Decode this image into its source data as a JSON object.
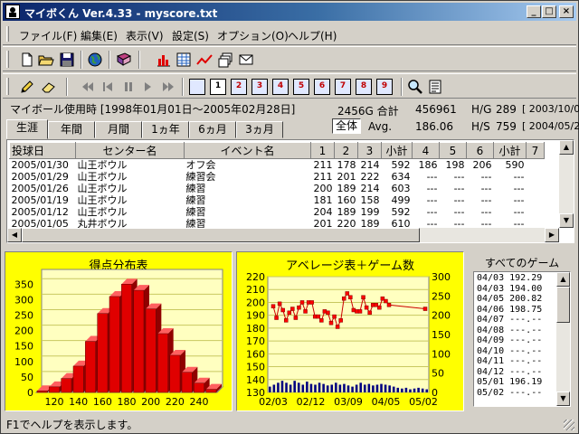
{
  "window": {
    "title": "マイボくん Ver.4.33 - myscore.txt",
    "minimize": "_",
    "maximize": "□",
    "close": "×"
  },
  "menu": [
    "ファイル(F)",
    "編集(E)",
    "表示(V)",
    "設定(S)",
    "オプション(O)",
    "ヘルプ(H)"
  ],
  "toolbar_icons": [
    "new-file-icon",
    "open-folder-icon",
    "save-icon",
    "globe-icon",
    "book-icon",
    "bar-chart-icon",
    "table-icon",
    "line-chart-icon",
    "copy-windows-icon",
    "mail-icon",
    "pencil-icon",
    "eraser-icon",
    "first-icon",
    "prev-icon",
    "pause-icon",
    "next-icon",
    "last-icon",
    "magnifier-icon",
    "document-icon"
  ],
  "view_buttons": [
    "",
    "1",
    "2",
    "3",
    "4",
    "5",
    "6",
    "7",
    "8",
    "9"
  ],
  "info": {
    "ball_usage": "マイボール使用時 [1998年01月01日～2005年02月28日]",
    "games_total": "2456G 合計",
    "total_value": "456961",
    "hg_label": "H/G",
    "hg_value": "289",
    "hg_date": "[ 2003/10/01 ]",
    "scope": "全体",
    "avg_label": "Avg.",
    "avg_value": "186.06",
    "hs_label": "H/S",
    "hs_value": "759",
    "hs_date": "[ 2004/05/29 ]"
  },
  "tabs": [
    "生涯",
    "年間",
    "月間",
    "1ヵ年",
    "6ヵ月",
    "3ヵ月"
  ],
  "grid": {
    "columns": [
      "投球日",
      "センター名",
      "イベント名",
      "1",
      "2",
      "3",
      "小計",
      "4",
      "5",
      "6",
      "小計",
      "7"
    ],
    "rows": [
      [
        "2005/01/30",
        "山王ボウル",
        "オフ会",
        "211",
        "178",
        "214",
        "592",
        "186",
        "198",
        "206",
        "590",
        ""
      ],
      [
        "2005/01/29",
        "山王ボウル",
        "練習会",
        "211",
        "201",
        "222",
        "634",
        "---",
        "---",
        "---",
        "---",
        ""
      ],
      [
        "2005/01/26",
        "山王ボウル",
        "練習",
        "200",
        "189",
        "214",
        "603",
        "---",
        "---",
        "---",
        "---",
        ""
      ],
      [
        "2005/01/19",
        "山王ボウル",
        "練習",
        "181",
        "160",
        "158",
        "499",
        "---",
        "---",
        "---",
        "---",
        ""
      ],
      [
        "2005/01/12",
        "山王ボウル",
        "練習",
        "204",
        "189",
        "199",
        "592",
        "---",
        "---",
        "---",
        "---",
        ""
      ],
      [
        "2005/01/05",
        "丸井ボウル",
        "練習",
        "201",
        "220",
        "189",
        "610",
        "---",
        "---",
        "---",
        "---",
        ""
      ]
    ]
  },
  "chart_data": [
    {
      "type": "bar",
      "title": "得点分布表",
      "categories": [
        "110",
        "120",
        "130",
        "140",
        "150",
        "160",
        "170",
        "180",
        "190",
        "200",
        "210",
        "220",
        "230",
        "240",
        "250"
      ],
      "tick_labels": [
        "120",
        "140",
        "160",
        "180",
        "200",
        "220",
        "240"
      ],
      "values": [
        5,
        18,
        45,
        85,
        165,
        255,
        310,
        350,
        330,
        270,
        190,
        120,
        65,
        30,
        10
      ],
      "ylim": [
        0,
        380
      ],
      "yticks": [
        "0",
        "50",
        "100",
        "150",
        "200",
        "250",
        "300",
        "350"
      ],
      "bar_color": "#e00000",
      "background": "#ffff00"
    },
    {
      "type": "line",
      "title": "アベレージ表＋ゲーム数",
      "x_tick_labels": [
        "02/03",
        "02/12",
        "03/09",
        "04/05",
        "05/02"
      ],
      "left_ylim": [
        130,
        220
      ],
      "left_yticks": [
        "130",
        "140",
        "150",
        "160",
        "170",
        "180",
        "190",
        "200",
        "210",
        "220"
      ],
      "right_ylim": [
        0,
        300
      ],
      "right_yticks": [
        "0",
        "50",
        "100",
        "150",
        "200",
        "250",
        "300"
      ],
      "average_series": [
        197,
        188,
        199,
        194,
        186,
        192,
        195,
        188,
        196,
        200,
        193,
        200,
        200,
        189,
        189,
        186,
        193,
        192,
        184,
        189,
        181,
        186,
        203,
        207,
        204,
        194,
        193,
        193,
        204,
        196,
        192,
        198,
        198,
        196,
        203,
        201,
        198
      ],
      "last_average": 195,
      "games_series": [
        15,
        20,
        25,
        30,
        25,
        20,
        30,
        25,
        20,
        28,
        22,
        20,
        25,
        22,
        18,
        20,
        25,
        20,
        22,
        18,
        15,
        20,
        25,
        20,
        22,
        18,
        20,
        22,
        20,
        18,
        15,
        12,
        10,
        12,
        8,
        10,
        12,
        10,
        8
      ],
      "line_color": "#cc0000",
      "marker_color": "#ff0000",
      "bar_color": "#000080",
      "background": "#ffff00"
    }
  ],
  "game_list": {
    "title": "すべてのゲーム",
    "items": [
      "04/03 192.29",
      "04/03 194.00",
      "04/05 200.82",
      "04/06 198.75",
      "04/07 ---.--",
      "04/08 ---.--",
      "04/09 ---.--",
      "04/10 ---.--",
      "04/11 ---.--",
      "04/12 ---.--",
      "05/01 196.19",
      "05/02 ---.--"
    ]
  },
  "status": "F1でヘルプを表示します。"
}
